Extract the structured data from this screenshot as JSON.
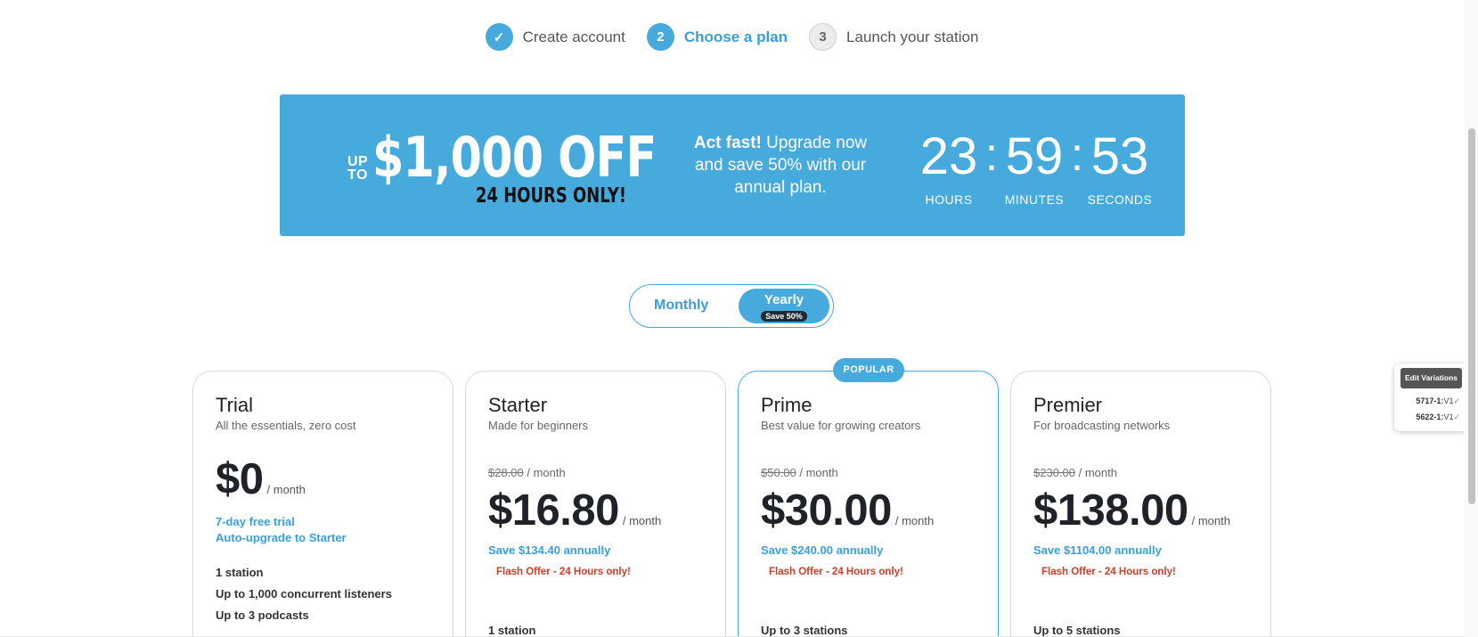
{
  "stepper": {
    "steps": [
      {
        "marker": "✓",
        "label": "Create account"
      },
      {
        "marker": "2",
        "label": "Choose a plan"
      },
      {
        "marker": "3",
        "label": "Launch your station"
      }
    ]
  },
  "banner": {
    "promo_upto": "UP TO",
    "promo_amount": "$1,000 OFF",
    "promo_duration": "24 HOURS ONLY!",
    "act_fast_bold": "Act fast!",
    "act_fast_text": " Upgrade now and save 50% with our annual plan.",
    "countdown": {
      "hours": "23",
      "minutes": "59",
      "seconds": "53",
      "hours_label": "HOURS",
      "minutes_label": "MINUTES",
      "seconds_label": "SECONDS",
      "separator": ":"
    }
  },
  "billing_toggle": {
    "monthly_label": "Monthly",
    "yearly_label": "Yearly",
    "yearly_badge": "Save 50%",
    "selected": "yearly"
  },
  "plans": [
    {
      "name": "Trial",
      "description": "All the essentials, zero cost",
      "price": "$0",
      "per": "/ month",
      "trial_note": "7-day free trial",
      "upgrade_note": "Auto-upgrade to Starter",
      "features": [
        "1 station",
        "Up to 1,000 concurrent listeners",
        "Up to 3 podcasts"
      ]
    },
    {
      "name": "Starter",
      "description": "Made for beginners",
      "original_price": "$28.00",
      "original_per": " / month",
      "price": "$16.80",
      "per": "/ month",
      "savings": "Save $134.40 annually",
      "flash": "Flash Offer - 24 Hours only!",
      "first_feature": "1 station"
    },
    {
      "name": "Prime",
      "badge": "POPULAR",
      "description": "Best value for growing creators",
      "original_price": "$50.00",
      "original_per": " / month",
      "price": "$30.00",
      "per": "/ month",
      "savings": "Save $240.00 annually",
      "flash": "Flash Offer - 24 Hours only!",
      "first_feature": "Up to 3 stations"
    },
    {
      "name": "Premier",
      "description": "For broadcasting networks",
      "original_price": "$230.00",
      "original_per": " / month",
      "price": "$138.00",
      "per": "/ month",
      "savings": "Save $1104.00 annually",
      "flash": "Flash Offer - 24 Hours only!",
      "first_feature": "Up to 5 stations"
    }
  ],
  "variations_widget": {
    "button": "Edit Variations",
    "rows": [
      {
        "id": "5717-1:",
        "value": "V1",
        "mark": "✓"
      },
      {
        "id": "5622-1:",
        "value": "V1",
        "mark": "✓"
      }
    ]
  },
  "colors": {
    "accent": "#46aadc",
    "flash": "#cc3d2a",
    "dark": "#1f2328"
  }
}
